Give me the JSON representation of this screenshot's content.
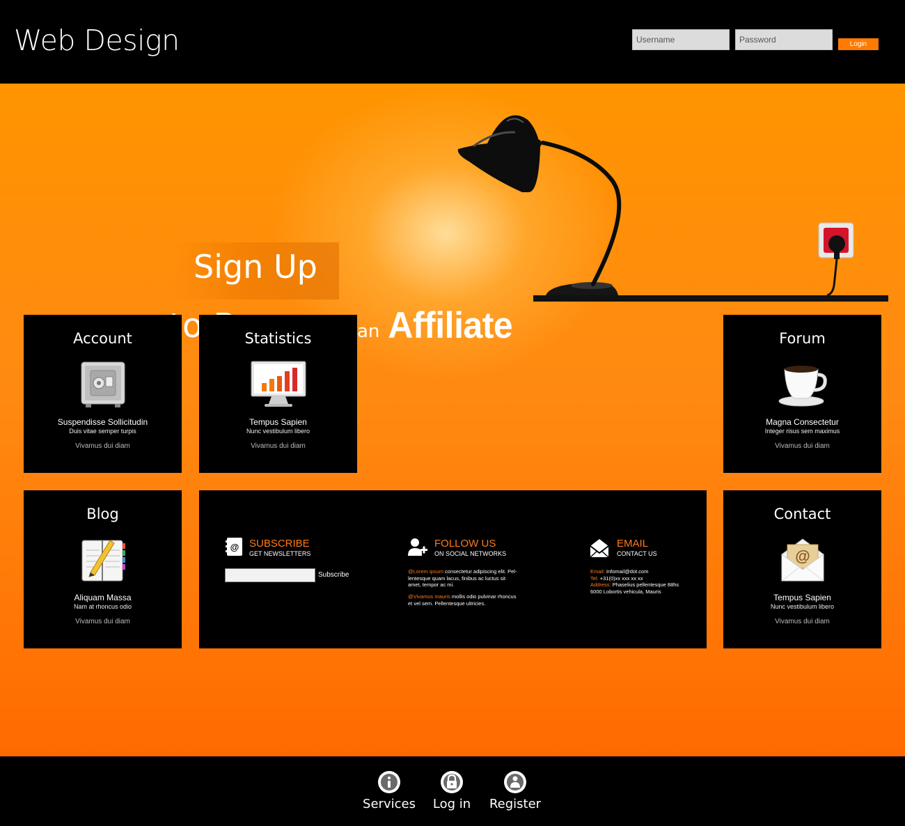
{
  "header": {
    "site_title": "Web Design",
    "username_placeholder": "Username",
    "password_placeholder": "Password",
    "login_label": "Login"
  },
  "hero": {
    "signup": "Sign Up",
    "become": "to Become",
    "an": "an",
    "affiliate": "Affiliate"
  },
  "tiles": {
    "account": {
      "title": "Account",
      "sub1": "Suspendisse Sollicitudin",
      "sub2": "Duis vitae semper turpis",
      "sub3": "Vivamus dui diam",
      "icon": "safe-icon"
    },
    "statistics": {
      "title": "Statistics",
      "sub1": "Tempus Sapien",
      "sub2": "Nunc vestibulum libero",
      "sub3": "Vivamus dui diam",
      "icon": "monitor-chart-icon"
    },
    "forum": {
      "title": "Forum",
      "sub1": "Magna Consectetur",
      "sub2": "Integer risus sem maximus",
      "sub3": "Vivamus dui diam",
      "icon": "coffee-cup-icon"
    },
    "blog": {
      "title": "Blog",
      "sub1": "Aliquam Massa",
      "sub2": "Nam at rhoncus odio",
      "sub3": "Vivamus dui diam",
      "icon": "notebook-pencil-icon"
    },
    "contact": {
      "title": "Contact",
      "sub1": "Tempus Sapien",
      "sub2": "Nunc vestibulum libero",
      "sub3": "Vivamus dui diam",
      "icon": "envelope-at-icon"
    }
  },
  "panel": {
    "subscribe": {
      "title": "SUBSCRIBE",
      "sub": "GET NEWSLETTERS",
      "button": "Subscribe"
    },
    "follow": {
      "title": "FOLLOW US",
      "sub": "ON SOCIAL NETWORKS",
      "p1_hl": "@Lorem ipsum",
      "p1_l1": " consectetur adipiscing elit. Pel-",
      "p1_l2": "lentesque quam lacus, finibus ac luctus sit",
      "p1_l3": "amet, tempor ac mi.",
      "p2_hl": "@Vivamus mauris",
      "p2_l1": " mollis odio pulvinar rhoncus",
      "p2_l2": "et vel sem. Pellentesque ultricies."
    },
    "email": {
      "title": "EMAIL",
      "sub": "CONTACT US",
      "email_label": "Email:",
      "email_value": " Infomail@dot.com",
      "tel_label": "Tel:",
      "tel_value": " +31(0)xx xxx xx xx",
      "address_label": "Address:",
      "address_value": " Phaselius pellentesque 88hs",
      "address_line2": "6000 Lobortis vehicula, Mauris"
    }
  },
  "footer": {
    "services": "Services",
    "login": "Log in",
    "register": "Register"
  },
  "colors": {
    "accent": "#ff7a00",
    "orange_top": "#ff9400",
    "orange_bottom": "#ff6a00",
    "black": "#000000"
  }
}
